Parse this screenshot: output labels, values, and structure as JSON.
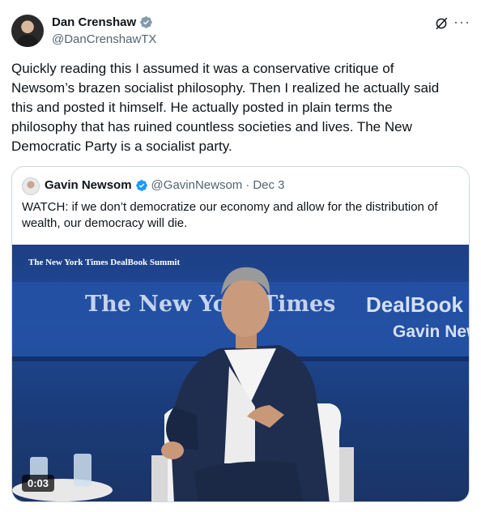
{
  "author": {
    "name": "Dan Crenshaw",
    "handle": "@DanCrenshawTX"
  },
  "icons": {
    "verified": "verified-badge-icon",
    "grok": "grok-icon",
    "more": "more-icon"
  },
  "colors": {
    "verified_gray": "#829aab",
    "verified_blue": "#1d9bf0",
    "muted_text": "#536471"
  },
  "tweet_text": "Quickly reading this I assumed it was a conservative critique of Newsom’s brazen socialist philosophy. Then I realized he actually said this and posted it himself. He actually posted in plain terms the philosophy that has ruined countless societies and lives. The New Democratic Party is a socialist party.",
  "more_label": "···",
  "quoted": {
    "name": "Gavin Newsom",
    "handle": "@GavinNewsom",
    "separator": "·",
    "date": "Dec 3",
    "text": "WATCH: if we don’t democratize our economy and allow for the distribution of wealth, our democracy will die.",
    "video": {
      "overlay_small": "The New York Times DealBook Summit",
      "backdrop_logo": "The New York Times",
      "backdrop_event": "DealBook S",
      "backdrop_guest": "Gavin New",
      "timecode": "0:03"
    }
  }
}
